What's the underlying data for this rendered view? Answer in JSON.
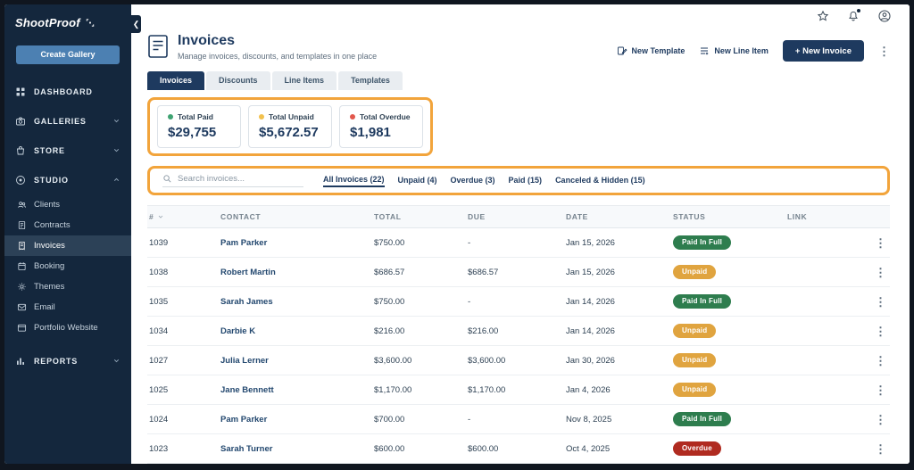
{
  "sidebar": {
    "logo_text": "ShootProof",
    "create_gallery_label": "Create Gallery",
    "nav": [
      {
        "label": "DASHBOARD"
      },
      {
        "label": "GALLERIES"
      },
      {
        "label": "STORE"
      },
      {
        "label": "STUDIO",
        "expanded": true
      }
    ],
    "studio_items": [
      {
        "label": "Clients"
      },
      {
        "label": "Contracts"
      },
      {
        "label": "Invoices",
        "active": true
      },
      {
        "label": "Booking"
      },
      {
        "label": "Themes"
      },
      {
        "label": "Email"
      },
      {
        "label": "Portfolio Website"
      }
    ],
    "reports_label": "REPORTS"
  },
  "header": {
    "title": "Invoices",
    "subtitle": "Manage invoices, discounts, and templates in one place",
    "actions": {
      "new_template": "New Template",
      "new_line_item": "New Line Item",
      "new_invoice": "+ New Invoice"
    }
  },
  "tabs": [
    {
      "label": "Invoices",
      "active": true
    },
    {
      "label": "Discounts"
    },
    {
      "label": "Line Items"
    },
    {
      "label": "Templates"
    }
  ],
  "stats": [
    {
      "label": "Total Paid",
      "value": "$29,755"
    },
    {
      "label": "Total Unpaid",
      "value": "$5,672.57"
    },
    {
      "label": "Total Overdue",
      "value": "$1,981"
    }
  ],
  "filters": {
    "search_placeholder": "Search invoices...",
    "links": [
      {
        "label": "All Invoices (22)",
        "active": true
      },
      {
        "label": "Unpaid (4)"
      },
      {
        "label": "Overdue (3)"
      },
      {
        "label": "Paid (15)"
      },
      {
        "label": "Canceled & Hidden (15)"
      }
    ]
  },
  "table": {
    "headers": [
      "#",
      "CONTACT",
      "TOTAL",
      "DUE",
      "DATE",
      "STATUS",
      "LINK"
    ],
    "rows": [
      {
        "id": "1039",
        "contact": "Pam Parker",
        "total": "$750.00",
        "due": "-",
        "date": "Jan 15, 2026",
        "status": "Paid In Full",
        "status_type": "paid"
      },
      {
        "id": "1038",
        "contact": "Robert Martin",
        "total": "$686.57",
        "due": "$686.57",
        "date": "Jan 15, 2026",
        "status": "Unpaid",
        "status_type": "unpaid"
      },
      {
        "id": "1035",
        "contact": "Sarah James",
        "total": "$750.00",
        "due": "-",
        "date": "Jan 14, 2026",
        "status": "Paid In Full",
        "status_type": "paid"
      },
      {
        "id": "1034",
        "contact": "Darbie K",
        "total": "$216.00",
        "due": "$216.00",
        "date": "Jan 14, 2026",
        "status": "Unpaid",
        "status_type": "unpaid"
      },
      {
        "id": "1027",
        "contact": "Julia Lerner",
        "total": "$3,600.00",
        "due": "$3,600.00",
        "date": "Jan 30, 2026",
        "status": "Unpaid",
        "status_type": "unpaid"
      },
      {
        "id": "1025",
        "contact": "Jane Bennett",
        "total": "$1,170.00",
        "due": "$1,170.00",
        "date": "Jan 4, 2026",
        "status": "Unpaid",
        "status_type": "unpaid"
      },
      {
        "id": "1024",
        "contact": "Pam Parker",
        "total": "$700.00",
        "due": "-",
        "date": "Nov 8, 2025",
        "status": "Paid In Full",
        "status_type": "paid"
      },
      {
        "id": "1023",
        "contact": "Sarah Turner",
        "total": "$600.00",
        "due": "$600.00",
        "date": "Oct 4, 2025",
        "status": "Overdue",
        "status_type": "overdue"
      }
    ]
  },
  "colors": {
    "sidebar_bg": "#14273D",
    "accent_blue": "#4C80B2",
    "navy": "#1E3A5F",
    "paid_green": "#2E7D4E",
    "unpaid_amber": "#E0A43F",
    "overdue_red": "#B02B20",
    "highlight_orange": "#F2A43B"
  }
}
